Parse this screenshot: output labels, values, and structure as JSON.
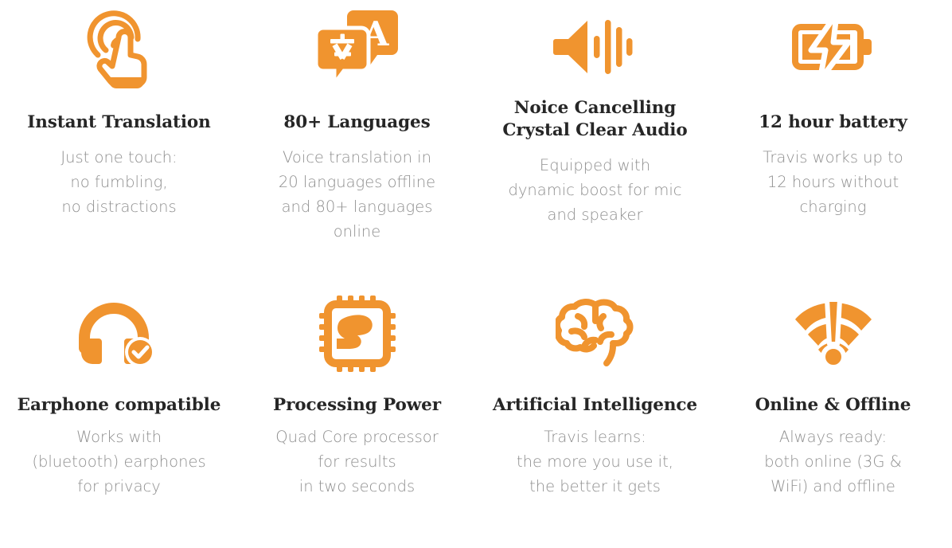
{
  "theme": {
    "accent": "#F0942F",
    "accent_light": "#F4A03F",
    "title_color": "#262626",
    "body_color": "#8f8f8f",
    "background": "#ffffff"
  },
  "features": [
    {
      "icon": "touch-tap-icon",
      "title": "Instant Translation",
      "description": "Just one touch:\nno fumbling,\nno distractions"
    },
    {
      "icon": "translate-speech-bubbles-icon",
      "title": "80+ Languages",
      "description": "Voice translation in\n20 languages offline\nand 80+ languages\nonline"
    },
    {
      "icon": "speaker-waveform-icon",
      "title": "Noice Cancelling\nCrystal Clear Audio",
      "description": "Equipped with\ndynamic boost for mic\nand speaker"
    },
    {
      "icon": "battery-charging-icon",
      "title": "12 hour battery",
      "description": "Travis works up to\n12 hours without\ncharging"
    },
    {
      "icon": "headphones-check-icon",
      "title": "Earphone compatible",
      "description": "Works with\n(bluetooth) earphones\nfor privacy"
    },
    {
      "icon": "cpu-chip-muscle-icon",
      "title": "Processing Power",
      "description": "Quad Core processor\nfor results\nin two seconds"
    },
    {
      "icon": "brain-icon",
      "title": "Artificial Intelligence",
      "description": "Travis learns:\nthe more you use it,\nthe better it gets"
    },
    {
      "icon": "wifi-exclamation-icon",
      "title": "Online & Offline",
      "description": "Always ready:\nboth online (3G &\nWiFi) and offline"
    }
  ]
}
